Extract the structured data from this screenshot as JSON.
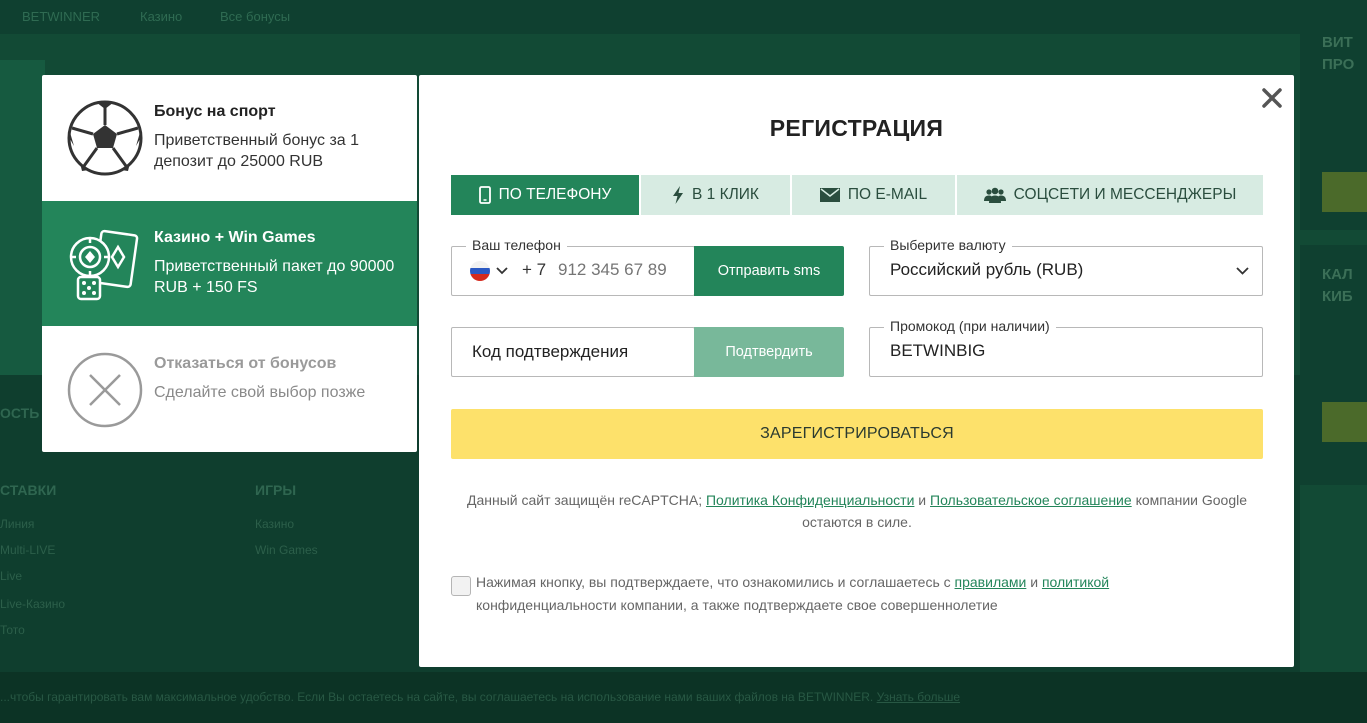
{
  "background": {
    "nav": [
      "BETWINNER",
      "Казино",
      "Все бонусы"
    ],
    "right_promo": [
      "ВИТ",
      "ПРО"
    ],
    "right_promo2": [
      "КАЛ",
      "КИБ"
    ],
    "section_partial": "ОСТЬ",
    "footer_col1_title": "СТАВКИ",
    "footer_col1_items": [
      "Линия",
      "Multi-LIVE",
      "Live",
      "Live-Казино",
      "Тото"
    ],
    "footer_col2_title": "ИГРЫ",
    "footer_col2_items": [
      "Казино",
      "Win Games"
    ],
    "cookie_text": "...чтобы гарантировать вам максимальное удобство. Если Вы остаетесь на сайте, вы соглашаетесь на использование нами ваших файлов на BETWINNER.",
    "cookie_link": "Узнать больше"
  },
  "bonuses": [
    {
      "title": "Бонус на спорт",
      "desc": "Приветственный бонус за 1 депозит до 25000 RUB",
      "icon": "soccer-ball-icon"
    },
    {
      "title": "Казино + Win Games",
      "desc": "Приветственный пакет до 90000 RUB + 150 FS",
      "icon": "casino-chips-cards-icon"
    },
    {
      "title": "Отказаться от бонусов",
      "desc": "Сделайте свой выбор позже",
      "icon": "close-circle-icon"
    }
  ],
  "modal": {
    "title": "РЕГИСТРАЦИЯ",
    "tabs": [
      {
        "label": "ПО ТЕЛЕФОНУ",
        "icon": "phone-icon",
        "active": true
      },
      {
        "label": "В 1 КЛИК",
        "icon": "lightning-icon",
        "active": false
      },
      {
        "label": "ПО E-MAIL",
        "icon": "envelope-icon",
        "active": false
      },
      {
        "label": "СОЦСЕТИ И МЕССЕНДЖЕРЫ",
        "icon": "users-icon",
        "active": false
      }
    ],
    "phone": {
      "label": "Ваш телефон",
      "code": "+ 7",
      "placeholder": "912 345 67 89",
      "send_button": "Отправить sms"
    },
    "currency": {
      "label": "Выберите валюту",
      "value": "Российский рубль (RUB)"
    },
    "code": {
      "placeholder": "Код подтверждения",
      "confirm_button": "Подтвердить"
    },
    "promo": {
      "label": "Промокод (при наличии)",
      "value": "BETWINBIG"
    },
    "register_button": "ЗАРЕГИСТРИРОВАТЬСЯ",
    "recaptcha": {
      "pre": "Данный сайт защищён reCAPTCHA;",
      "privacy_link": "Политика Конфиденциальности",
      "and": "и",
      "terms_link": "Пользовательское соглашение",
      "post": "компании Google остаются в силе."
    },
    "consent": {
      "pre": "Нажимая кнопку, вы подтверждаете, что ознакомились и соглашаетесь с",
      "rules_link": "правилами",
      "and": "и",
      "policy_link": "политикой",
      "post": "конфиденциальности компании, а также подтверждаете свое совершеннолетие"
    }
  },
  "colors": {
    "accent": "#23855a",
    "register": "#fde16b",
    "tab_inactive": "#d7ebe2"
  }
}
